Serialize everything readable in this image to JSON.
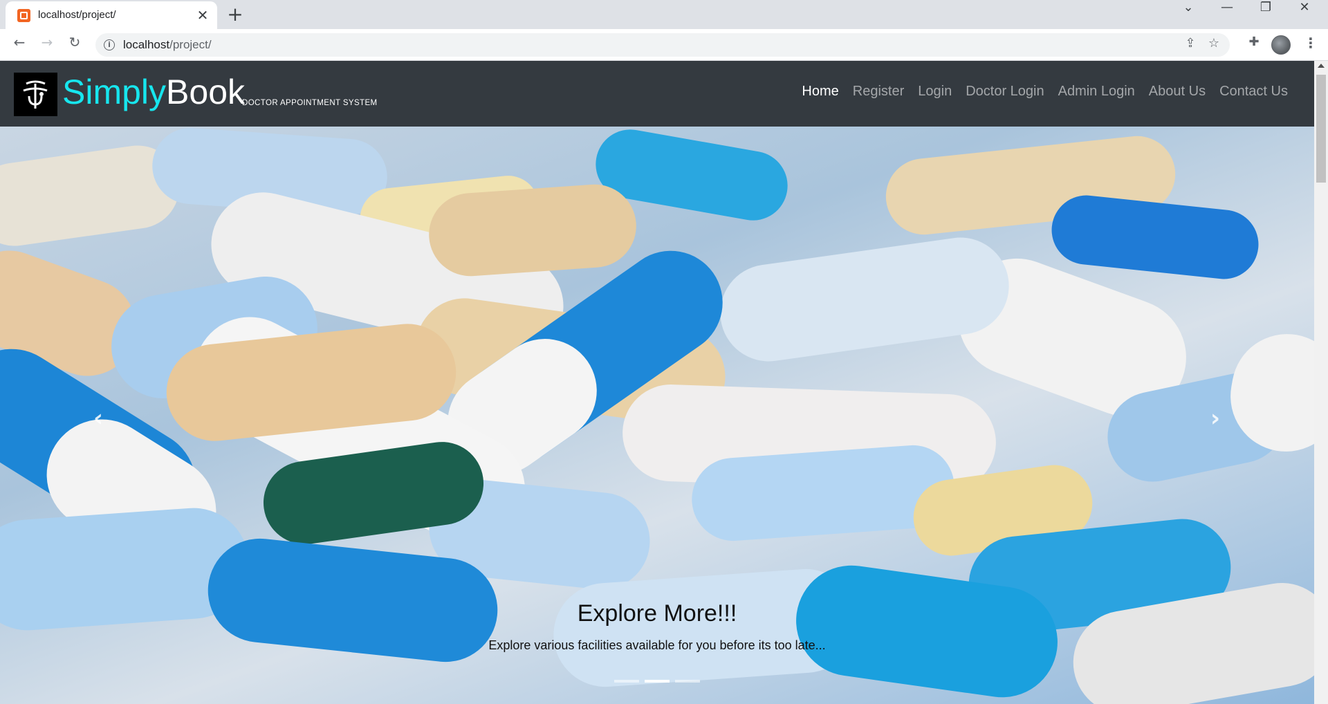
{
  "browser": {
    "tab_title": "localhost/project/",
    "tab_close": "✕",
    "new_tab": "+",
    "url_host": "localhost",
    "url_path": "/project/",
    "info": "i"
  },
  "site": {
    "brand_part1": "Simply",
    "brand_part2": "Book",
    "brand_subtitle": "DOCTOR APPOINTMENT SYSTEM",
    "menu": [
      {
        "label": "Home"
      },
      {
        "label": "Register"
      },
      {
        "label": "Login"
      },
      {
        "label": "Doctor Login"
      },
      {
        "label": "Admin Login"
      },
      {
        "label": "About Us"
      },
      {
        "label": "Contact Us"
      }
    ]
  },
  "carousel": {
    "title": "Explore More!!!",
    "text": "Explore various facilities available for you before its too late...",
    "slide_count": 3,
    "active_slide": 2
  },
  "colors": {
    "navbar_bg": "#343a40",
    "brand_accent": "#17e6ee"
  }
}
